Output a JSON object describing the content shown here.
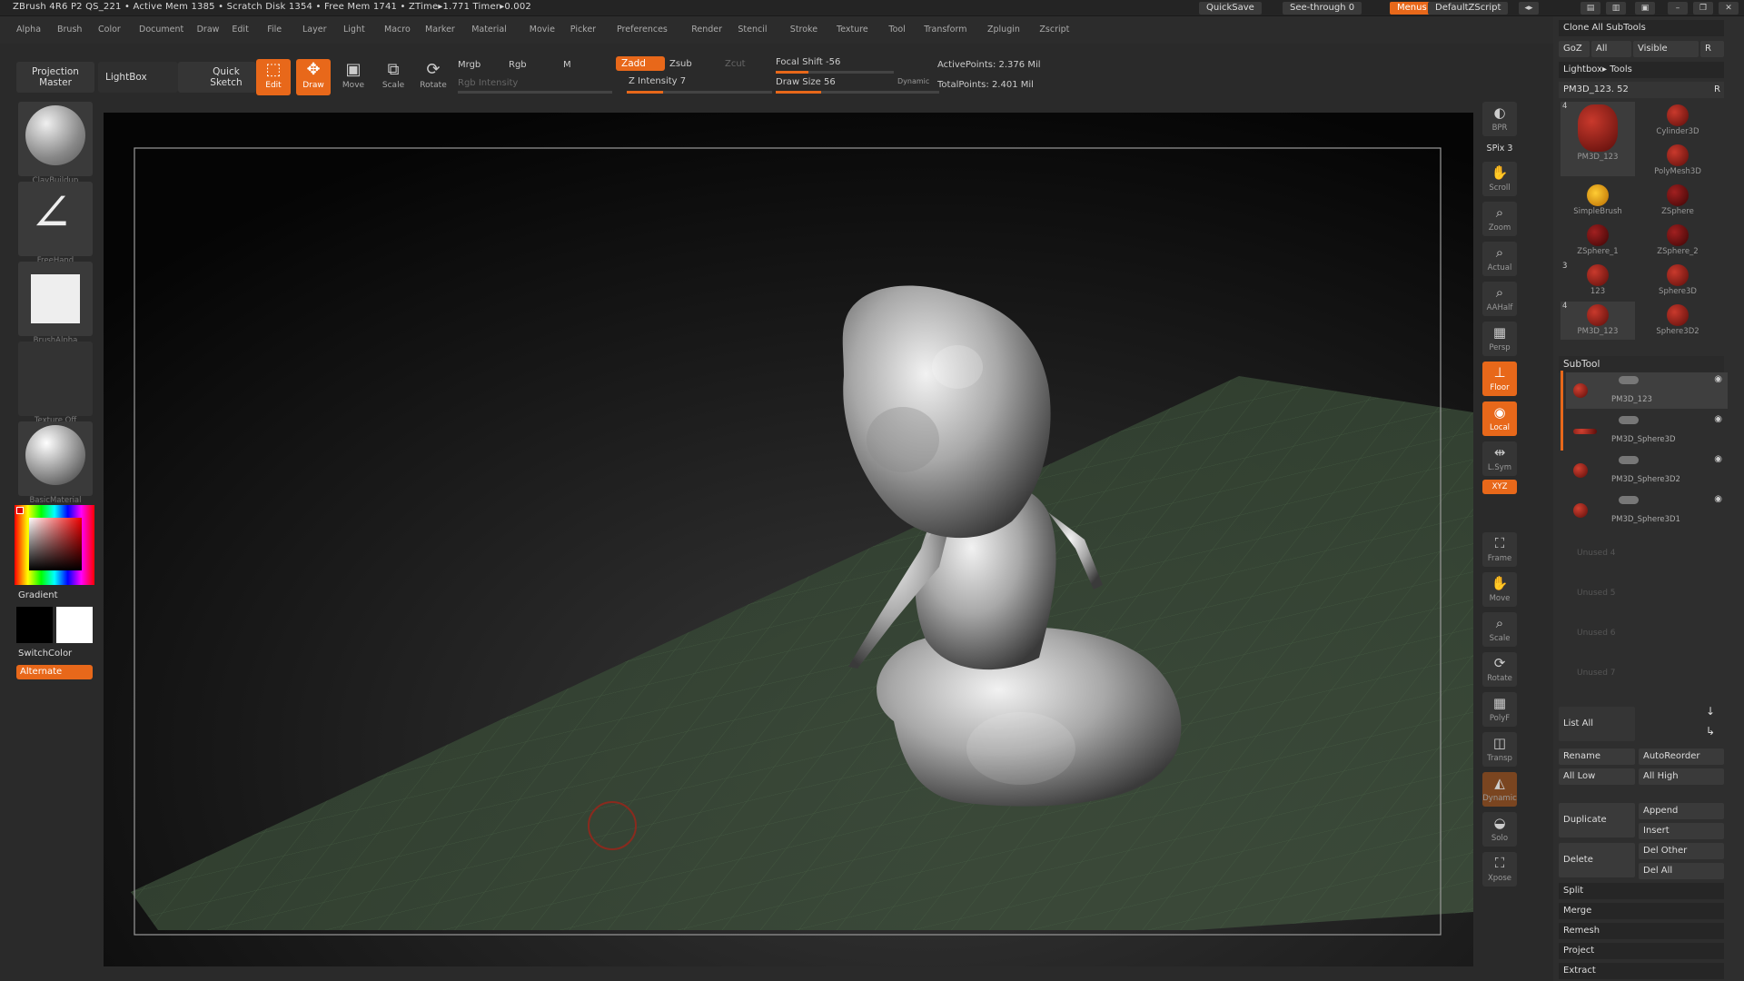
{
  "titlebar": {
    "info": "ZBrush 4R6 P2     QS_221     • Active Mem 1385 • Scratch Disk 1354 • Free Mem 1741 • ZTime▸1.771  Timer▸0.002",
    "quicksave": "QuickSave",
    "seethrough": "See-through   0",
    "menus": "Menus",
    "script": "DefaultZScript"
  },
  "menu": [
    "Alpha",
    "Brush",
    "Color",
    "Document",
    "Draw",
    "Edit",
    "File",
    "Layer",
    "Light",
    "Macro",
    "Marker",
    "Material",
    "Movie",
    "Picker",
    "Preferences",
    "Render",
    "Stencil",
    "Stroke",
    "Texture",
    "Tool",
    "Transform",
    "Zplugin",
    "Zscript"
  ],
  "toolbar": {
    "projection_master": "Projection Master",
    "lightbox": "LightBox",
    "quick_sketch": "Quick Sketch",
    "edit": "Edit",
    "draw": "Draw",
    "move": "Move",
    "scale": "Scale",
    "rotate": "Rotate",
    "mrgb": "Mrgb",
    "rgb": "Rgb",
    "m": "M",
    "rgb_intensity": "Rgb Intensity",
    "zadd": "Zadd",
    "zsub": "Zsub",
    "zcut": "Zcut",
    "z_intensity": "Z Intensity 7",
    "focal_shift": "Focal Shift -56",
    "draw_size": "Draw Size 56",
    "dynamic": "Dynamic",
    "active_points": "ActivePoints: 2.376  Mil",
    "total_points": "TotalPoints: 2.401  Mil"
  },
  "lefttray": {
    "brush1": "ClayBuildup",
    "stroke": "FreeHand",
    "alpha": "BrushAlpha",
    "texture": "Texture Off",
    "material": "BasicMaterial",
    "gradient": "Gradient",
    "switchcolor": "SwitchColor",
    "alternate": "Alternate"
  },
  "rshelf": [
    "BPR",
    "SPix 3",
    "Scroll",
    "Zoom",
    "Actual",
    "AAHalf",
    "Persp",
    "Floor",
    "Local",
    "L.Sym",
    "XYZ",
    "Frame",
    "Move",
    "Scale",
    "Rotate",
    "PolyF",
    "Transp",
    "Dynamic",
    "Solo",
    "Xpose"
  ],
  "rpanel": {
    "clone": "Clone  All  SubTools",
    "goz": "GoZ",
    "all": "All",
    "visible": "Visible",
    "r": "R",
    "lightbox_tools": "Lightbox▸ Tools",
    "current_tool": "PM3D_123. 52",
    "tools": [
      {
        "name": "PM3D_123",
        "num": "4"
      },
      {
        "name": "Cylinder3D"
      },
      {
        "name": "PolyMesh3D"
      },
      {
        "name": "SimpleBrush"
      },
      {
        "name": "ZSphere"
      },
      {
        "name": "ZSphere_1"
      },
      {
        "name": "ZSphere_2"
      },
      {
        "name": "123",
        "num": "3"
      },
      {
        "name": "Sphere3D"
      },
      {
        "name": "PM3D_123",
        "num": "4"
      },
      {
        "name": "Sphere3D2"
      }
    ],
    "subtool_title": "SubTool",
    "subtools": [
      "PM3D_123",
      "PM3D_Sphere3D",
      "PM3D_Sphere3D2",
      "PM3D_Sphere3D1"
    ],
    "unused": [
      "Unused 4",
      "Unused 5",
      "Unused 6",
      "Unused 7"
    ],
    "list_all": "List  All",
    "rename": "Rename",
    "autoreorder": "AutoReorder",
    "all_low": "All  Low",
    "all_high": "All  High",
    "duplicate": "Duplicate",
    "append": "Append",
    "insert": "Insert",
    "delete": "Delete",
    "del_other": "Del  Other",
    "del_all": "Del  All",
    "split": "Split",
    "merge": "Merge",
    "remesh": "Remesh",
    "project": "Project",
    "extract": "Extract"
  },
  "colors": {
    "accent": "#e8681a",
    "floor": "#3a4a38",
    "bg": "#2a2a2a"
  }
}
